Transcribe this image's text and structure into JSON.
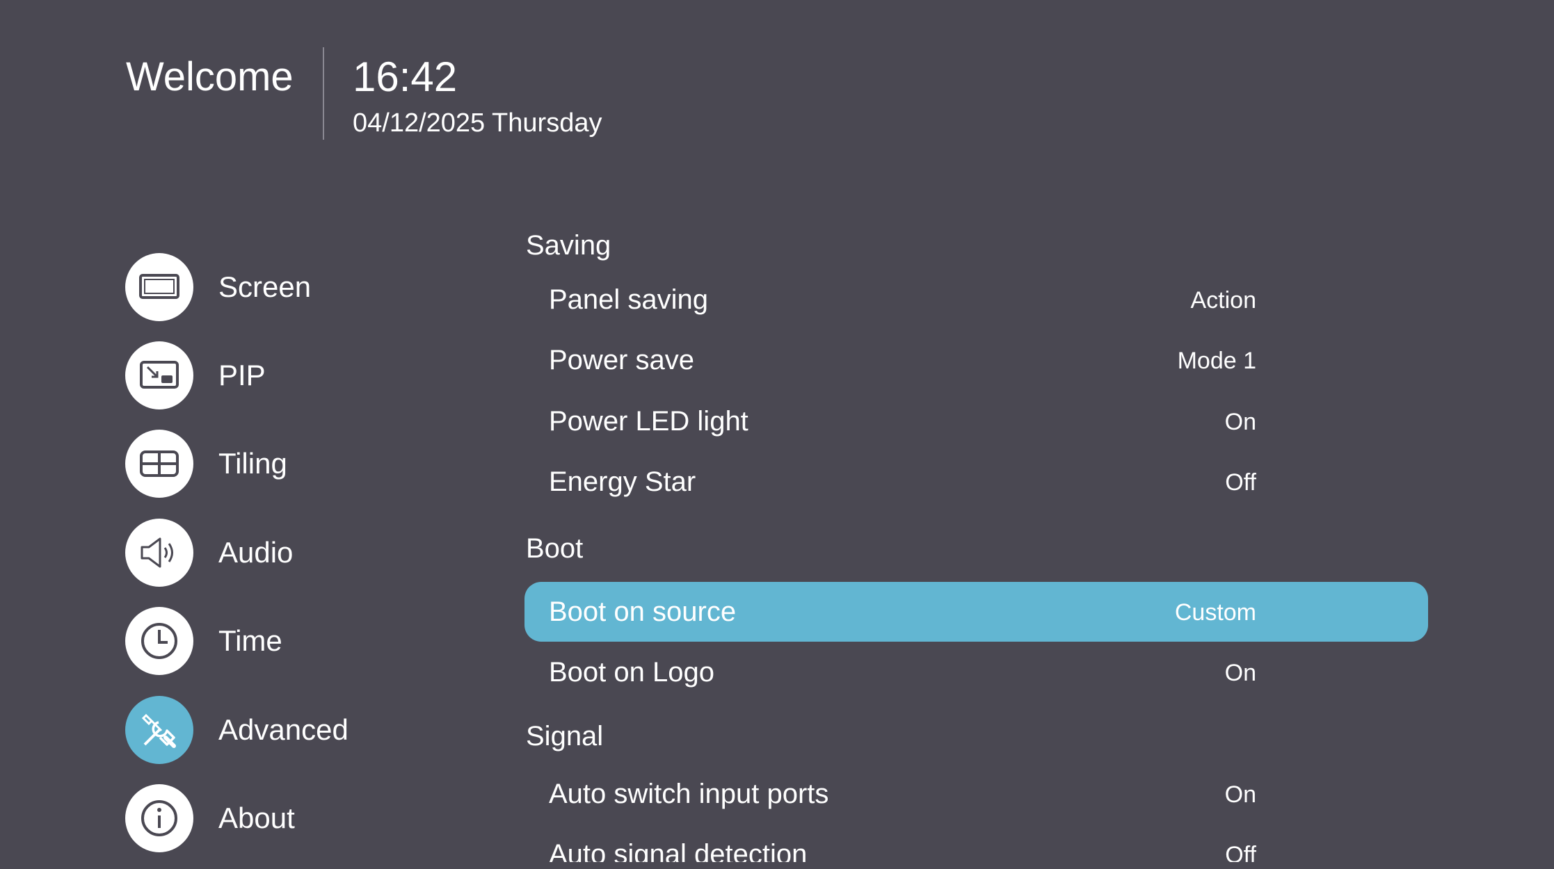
{
  "header": {
    "welcome": "Welcome",
    "time": "16:42",
    "date": "04/12/2025 Thursday"
  },
  "sidebar": {
    "items": [
      {
        "label": "Screen",
        "icon": "screen-icon"
      },
      {
        "label": "PIP",
        "icon": "pip-icon"
      },
      {
        "label": "Tiling",
        "icon": "tiling-icon"
      },
      {
        "label": "Audio",
        "icon": "audio-icon"
      },
      {
        "label": "Time",
        "icon": "clock-icon"
      },
      {
        "label": "Advanced",
        "icon": "tools-icon",
        "active": true
      },
      {
        "label": "About",
        "icon": "info-icon"
      }
    ]
  },
  "main": {
    "sections": [
      {
        "title": "Saving",
        "rows": [
          {
            "label": "Panel saving",
            "value": "Action"
          },
          {
            "label": "Power save",
            "value": "Mode 1"
          },
          {
            "label": "Power LED light",
            "value": "On"
          },
          {
            "label": "Energy Star",
            "value": "Off"
          }
        ]
      },
      {
        "title": "Boot",
        "rows": [
          {
            "label": "Boot on source",
            "value": "Custom",
            "selected": true
          },
          {
            "label": "Boot on Logo",
            "value": "On"
          }
        ]
      },
      {
        "title": "Signal",
        "rows": [
          {
            "label": "Auto switch input ports",
            "value": "On"
          },
          {
            "label": "Auto signal detection",
            "value": "Off"
          }
        ]
      }
    ]
  },
  "colors": {
    "background": "#4a4852",
    "accent": "#62b6d2",
    "text": "#ffffff",
    "icon": "#4a4852"
  }
}
